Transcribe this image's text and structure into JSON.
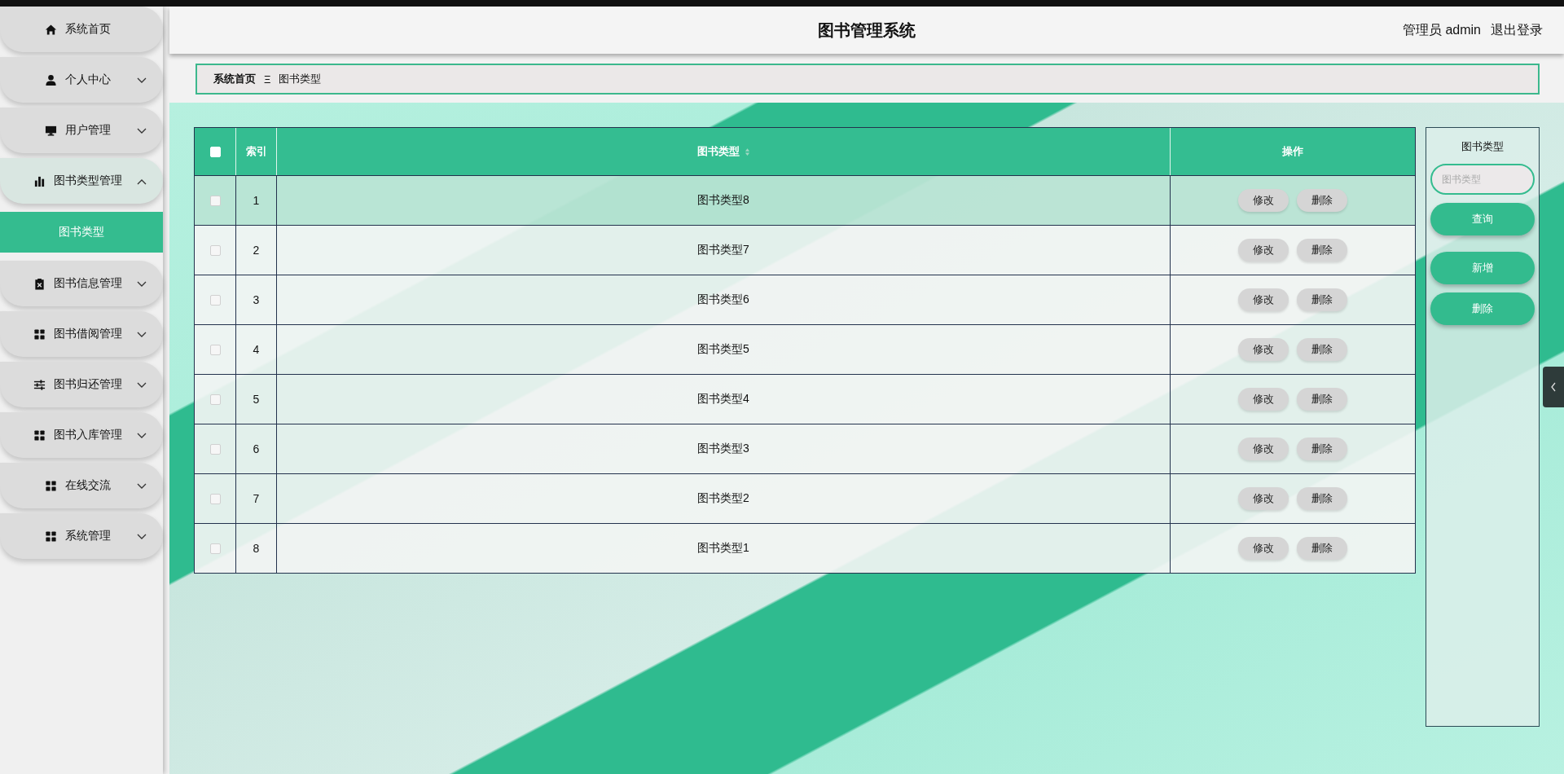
{
  "header": {
    "title": "图书管理系统",
    "user": "管理员 admin",
    "logout": "退出登录"
  },
  "sidebar": {
    "items": [
      {
        "label": "系统首页"
      },
      {
        "label": "个人中心",
        "expanded": false
      },
      {
        "label": "用户管理",
        "expanded": false
      },
      {
        "label": "图书类型管理",
        "expanded": true,
        "children": [
          {
            "label": "图书类型",
            "selected": true
          }
        ]
      },
      {
        "label": "图书信息管理",
        "expanded": false
      },
      {
        "label": "图书借阅管理",
        "expanded": false
      },
      {
        "label": "图书归还管理",
        "expanded": false
      },
      {
        "label": "图书入库管理",
        "expanded": false
      },
      {
        "label": "在线交流",
        "expanded": false
      },
      {
        "label": "系统管理",
        "expanded": false
      }
    ]
  },
  "breadcrumb": {
    "items": [
      "系统首页",
      "图书类型"
    ],
    "separator": "Ξ"
  },
  "table": {
    "select_all": {
      "checked": false
    },
    "columns": [
      {
        "label": "索引",
        "sortable": false
      },
      {
        "label": "图书类型",
        "sortable": true
      },
      {
        "label": "操作",
        "sortable": false
      }
    ],
    "rows": [
      {
        "checked": false,
        "hovered": true,
        "index": "1",
        "type": "图书类型8",
        "actions": [
          "修改",
          "删除"
        ]
      },
      {
        "checked": false,
        "hovered": false,
        "index": "2",
        "type": "图书类型7",
        "actions": [
          "修改",
          "删除"
        ]
      },
      {
        "checked": false,
        "hovered": false,
        "index": "3",
        "type": "图书类型6",
        "actions": [
          "修改",
          "删除"
        ]
      },
      {
        "checked": false,
        "hovered": false,
        "index": "4",
        "type": "图书类型5",
        "actions": [
          "修改",
          "删除"
        ]
      },
      {
        "checked": false,
        "hovered": false,
        "index": "5",
        "type": "图书类型4",
        "actions": [
          "修改",
          "删除"
        ]
      },
      {
        "checked": false,
        "hovered": false,
        "index": "6",
        "type": "图书类型3",
        "actions": [
          "修改",
          "删除"
        ]
      },
      {
        "checked": false,
        "hovered": false,
        "index": "7",
        "type": "图书类型2",
        "actions": [
          "修改",
          "删除"
        ]
      },
      {
        "checked": false,
        "hovered": false,
        "index": "8",
        "type": "图书类型1",
        "actions": [
          "修改",
          "删除"
        ]
      }
    ]
  },
  "search_panel": {
    "label": "图书类型",
    "placeholder": "图书类型",
    "buttons": [
      "查询",
      "新增",
      "删除"
    ]
  }
}
